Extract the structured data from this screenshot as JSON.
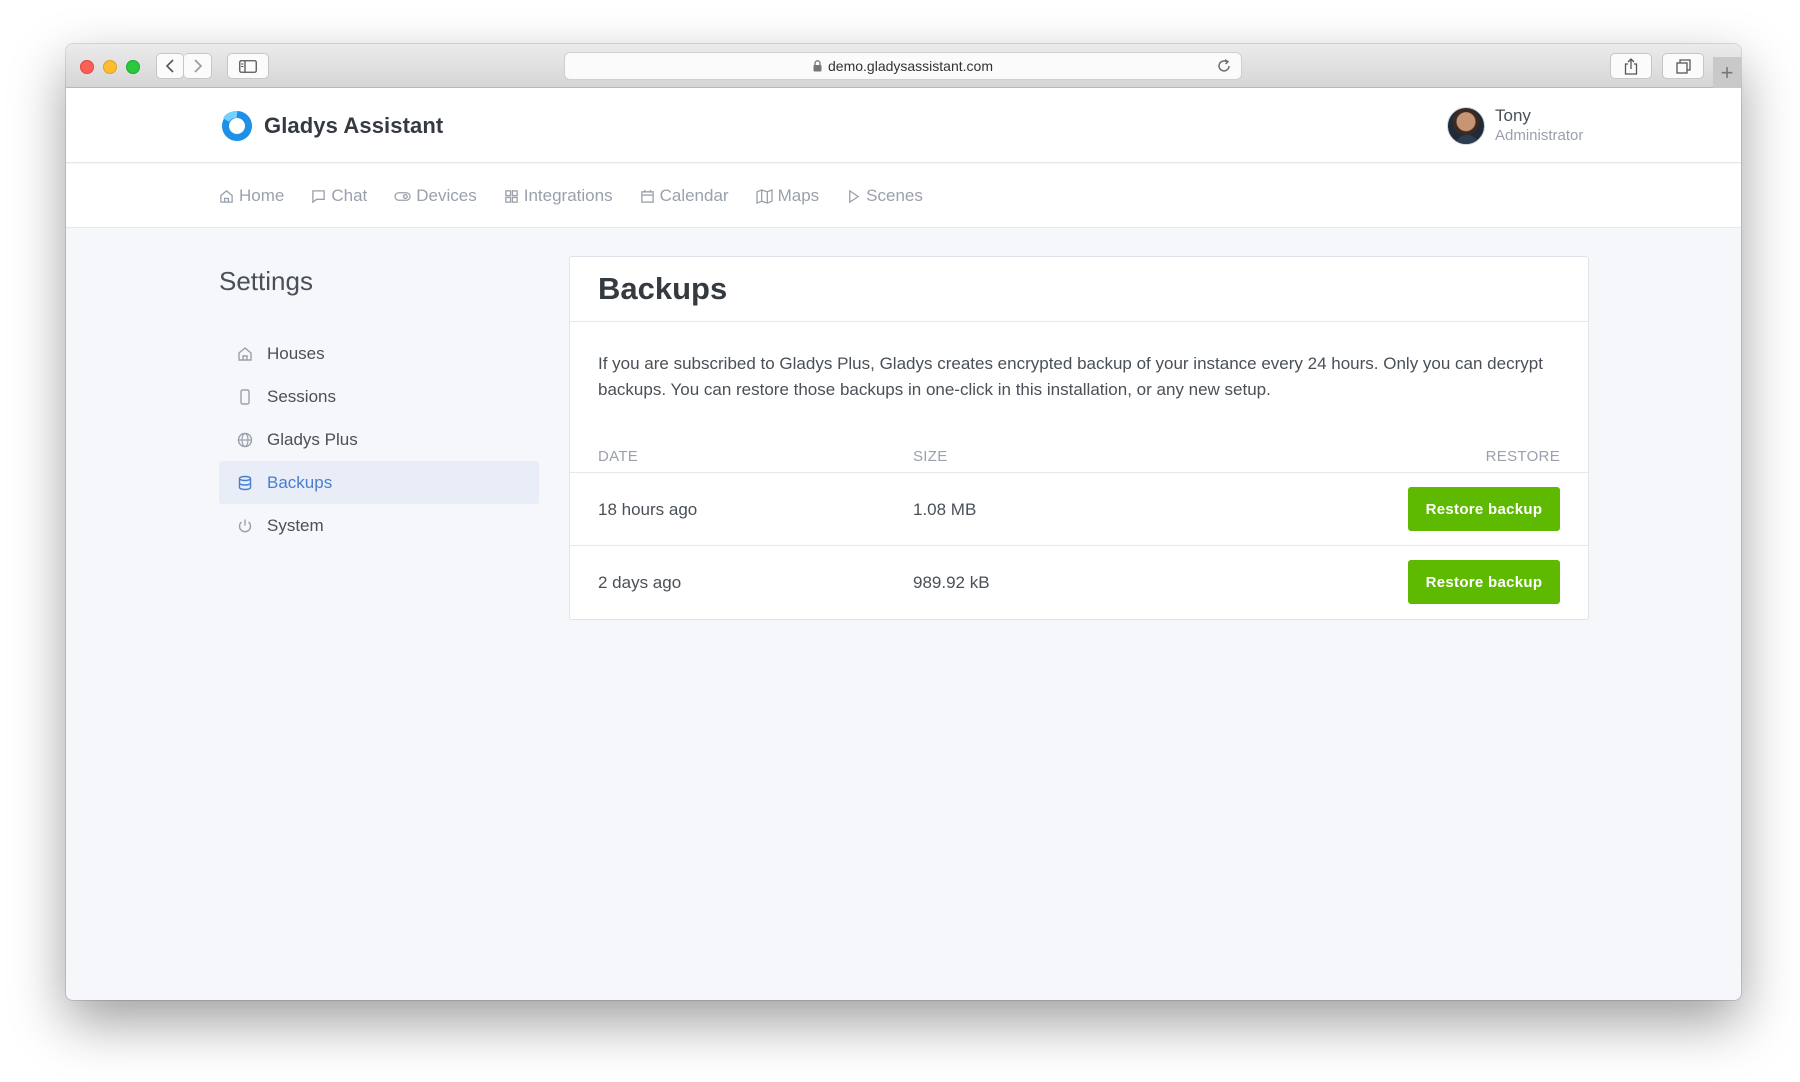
{
  "browser": {
    "url": "demo.gladysassistant.com"
  },
  "header": {
    "brand": "Gladys Assistant",
    "user_name": "Tony",
    "user_role": "Administrator"
  },
  "nav": {
    "items": [
      {
        "label": "Home",
        "icon": "home-icon"
      },
      {
        "label": "Chat",
        "icon": "chat-icon"
      },
      {
        "label": "Devices",
        "icon": "devices-icon"
      },
      {
        "label": "Integrations",
        "icon": "grid-icon"
      },
      {
        "label": "Calendar",
        "icon": "calendar-icon"
      },
      {
        "label": "Maps",
        "icon": "map-icon"
      },
      {
        "label": "Scenes",
        "icon": "play-icon"
      }
    ]
  },
  "settings": {
    "title": "Settings",
    "items": [
      {
        "label": "Houses",
        "icon": "house-icon"
      },
      {
        "label": "Sessions",
        "icon": "phone-icon"
      },
      {
        "label": "Gladys Plus",
        "icon": "globe-icon"
      },
      {
        "label": "Backups",
        "icon": "database-icon",
        "active": true
      },
      {
        "label": "System",
        "icon": "power-icon"
      }
    ]
  },
  "backups": {
    "title": "Backups",
    "description": "If you are subscribed to Gladys Plus, Gladys creates encrypted backup of your instance every 24 hours. Only you can decrypt backups. You can restore those backups in one-click in this installation, or any new setup.",
    "columns": {
      "date": "DATE",
      "size": "SIZE",
      "restore": "RESTORE"
    },
    "rows": [
      {
        "date": "18 hours ago",
        "size": "1.08 MB",
        "button": "Restore backup"
      },
      {
        "date": "2 days ago",
        "size": "989.92 kB",
        "button": "Restore backup"
      }
    ]
  },
  "colors": {
    "accent": "#467fcf",
    "success": "#5eba00",
    "muted": "#9aa0ac"
  }
}
